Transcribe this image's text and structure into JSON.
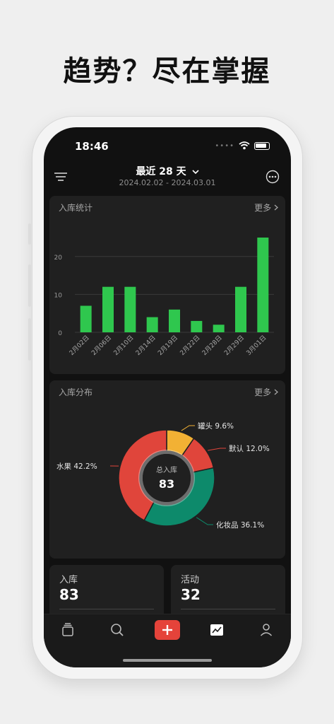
{
  "headline": "趋势？尽在掌握",
  "status": {
    "time": "18:46"
  },
  "header": {
    "title": "最近 28 天",
    "subtitle": "2024.02.02 - 2024.03.01"
  },
  "inbound_stats": {
    "title": "入库统计",
    "more_label": "更多"
  },
  "inbound_distribution": {
    "title": "入库分布",
    "more_label": "更多",
    "center_label": "总入库",
    "center_value": "83"
  },
  "stats": [
    {
      "label": "入库",
      "value": "83"
    },
    {
      "label": "活动",
      "value": "32"
    }
  ],
  "colors": {
    "bar_green": "#2fc74e",
    "slice_yellow": "#f2b134",
    "slice_red": "#e0453b",
    "slice_teal": "#0d8a6b",
    "tab_add": "#e5433a"
  },
  "tabs": [
    "box-stack-icon",
    "search-icon",
    "add-icon",
    "chart-icon",
    "person-icon"
  ],
  "chart_data": [
    {
      "type": "bar",
      "title": "入库统计",
      "categories": [
        "2月02日",
        "2月06日",
        "2月10日",
        "2月14日",
        "2月19日",
        "2月22日",
        "2月28日",
        "2月29日",
        "3月01日"
      ],
      "values": [
        7,
        12,
        12,
        4,
        6,
        3,
        2,
        12,
        25
      ],
      "ylim": [
        0,
        25
      ],
      "yticks": [
        "0",
        "10",
        "20"
      ],
      "grid": true
    },
    {
      "type": "pie",
      "title": "入库分布",
      "labels": [
        "罐头",
        "默认",
        "化妆品",
        "水果"
      ],
      "display": [
        "罐头 9.6%",
        "默认 12.0%",
        "化妆品 36.1%",
        "水果 42.2%"
      ],
      "values": [
        9.6,
        12.0,
        36.1,
        42.2
      ],
      "colors": [
        "#f2b134",
        "#e0453b",
        "#0d8a6b",
        "#e0453b"
      ]
    }
  ]
}
